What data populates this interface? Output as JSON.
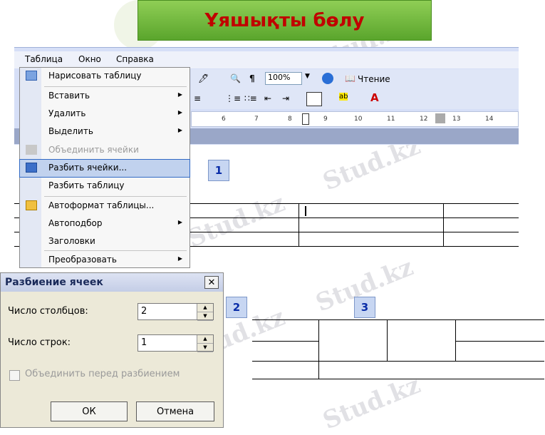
{
  "title": "Ұяшықты бөлу",
  "menubar": {
    "items": [
      "Таблица",
      "Окно",
      "Справка"
    ]
  },
  "toolbar": {
    "zoom": "100%",
    "reading": "Чтение",
    "paragraph_mark": "¶"
  },
  "ruler": {
    "ticks": [
      "6",
      "7",
      "8",
      "9",
      "10",
      "11",
      "12",
      "13",
      "14"
    ]
  },
  "menu": {
    "items": [
      {
        "label": "Нарисовать таблицу",
        "icon": "pencil-table-icon"
      },
      {
        "label": "Вставить",
        "submenu": true
      },
      {
        "label": "Удалить",
        "submenu": true
      },
      {
        "label": "Выделить",
        "submenu": true
      },
      {
        "label": "Объединить ячейки",
        "disabled": true,
        "icon": "merge-cells-icon"
      },
      {
        "label": "Разбить ячейки...",
        "selected": true,
        "icon": "split-cells-icon"
      },
      {
        "label": "Разбить таблицу"
      },
      {
        "label": "Автоформат таблицы...",
        "icon": "autoformat-icon"
      },
      {
        "label": "Автоподбор",
        "submenu": true
      },
      {
        "label": "Заголовки"
      },
      {
        "label": "Преобразовать",
        "submenu": true
      }
    ]
  },
  "badges": [
    "1",
    "2",
    "3"
  ],
  "dialog": {
    "title": "Разбиение ячеек",
    "columns_label": "Число столбцов:",
    "columns_value": "2",
    "rows_label": "Число строк:",
    "rows_value": "1",
    "merge_label": "Объединить перед разбиением",
    "ok": "ОК",
    "cancel": "Отмена",
    "close": "✕"
  },
  "watermark": "Stud.kz"
}
